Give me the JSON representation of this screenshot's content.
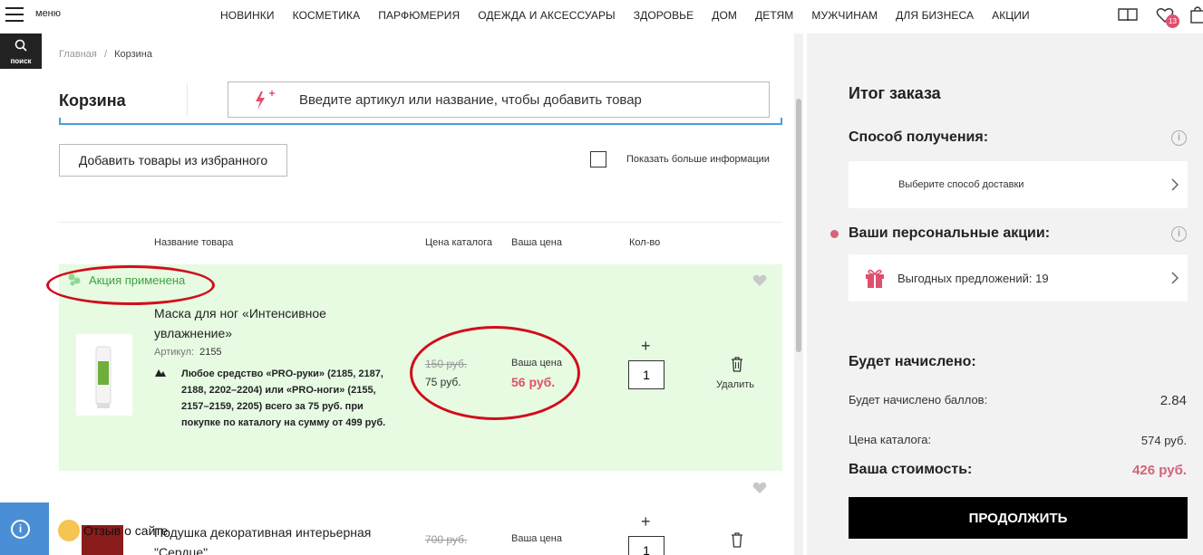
{
  "header": {
    "menu_label": "меню",
    "nav": [
      "НОВИНКИ",
      "КОСМЕТИКА",
      "ПАРФЮМЕРИЯ",
      "ОДЕЖДА И АКСЕССУАРЫ",
      "ЗДОРОВЬЕ",
      "ДОМ",
      "ДЕТЯМ",
      "МУЖЧИНАМ",
      "ДЛЯ БИЗНЕСА",
      "АКЦИИ"
    ],
    "favorites_count": "13",
    "search_label": "поиск"
  },
  "breadcrumb": {
    "home": "Главная",
    "sep": "/",
    "current": "Корзина"
  },
  "cart": {
    "title": "Корзина",
    "quick_add_placeholder": "Введите артикул или название, чтобы добавить товар",
    "add_from_favorites": "Добавить товары из избранного",
    "more_info_label": "Показать больше информации",
    "columns": {
      "name": "Название товара",
      "catalog_price": "Цена каталога",
      "your_price": "Ваша цена",
      "qty": "Кол-во"
    }
  },
  "items": [
    {
      "promo_applied": "Акция применена",
      "name": "Маска для ног «Интенсивное увлажнение»",
      "article_label": "Артикул:",
      "article": "2155",
      "promo_text": "Любое средство «PRO-руки» (2185, 2187, 2188, 2202–2204) или «PRO-ноги» (2155, 2157–2159, 2205) всего за 75 руб. при покупке по каталогу на сумму от 499 руб.",
      "old_price": "150 руб.",
      "catalog_price": "75 руб.",
      "your_price_label": "Ваша цена",
      "your_price": "56 руб.",
      "qty": "1",
      "delete_label": "Удалить"
    },
    {
      "name": "Подушка декоративная интерьерная \"Сердце\"",
      "old_price": "700 руб.",
      "your_price_label": "Ваша цена",
      "qty": "1"
    }
  ],
  "summary": {
    "title": "Итог заказа",
    "delivery_title": "Способ получения:",
    "delivery_choose": "Выберите способ доставки",
    "promos_title": "Ваши персональные акции:",
    "promos_offers": "Выгодных предложений: 19",
    "accrual_title": "Будет начислено:",
    "points_label": "Будет начислено баллов:",
    "points_value": "2.84",
    "catalog_label": "Цена каталога:",
    "catalog_value": "574 руб.",
    "total_label": "Ваша стоимость:",
    "total_value": "426 руб.",
    "continue": "ПРОДОЛЖИТЬ"
  },
  "feedback": {
    "label": "Отзыв о сайте"
  }
}
